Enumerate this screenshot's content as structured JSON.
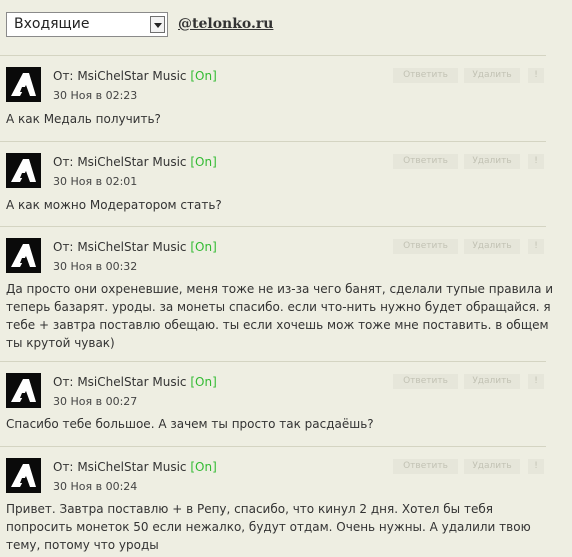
{
  "header": {
    "folder_select": "Входящие",
    "site_link": "@telonko.ru"
  },
  "actions": {
    "reply": "Ответить",
    "delete": "Удалить",
    "more": "!"
  },
  "messages": [
    {
      "from_prefix": "От:",
      "sender": "MsiChelStar Music",
      "status": "[On]",
      "date": "30 Ноя в 02:23",
      "body": "А как Медаль получить?"
    },
    {
      "from_prefix": "От:",
      "sender": "MsiChelStar Music",
      "status": "[On]",
      "date": "30 Ноя в 02:01",
      "body": "А как можно Модератором стать?"
    },
    {
      "from_prefix": "От:",
      "sender": "MsiChelStar Music",
      "status": "[On]",
      "date": "30 Ноя в 00:32",
      "body": "Да просто они охреневшие, меня тоже не из-за чего банят, сделали тупые правила и теперь базарят. уроды. за монеты спасибо. если что-нить нужно будет обращайся. я тебе + завтра поставлю обещаю. ты если хочешь мож тоже мне поставить. в общем ты крутой чувак)"
    },
    {
      "from_prefix": "От:",
      "sender": "MsiChelStar Music",
      "status": "[On]",
      "date": "30 Ноя в 00:27",
      "body": "Спасибо тебе большое. А зачем ты просто так расдаёшь?"
    },
    {
      "from_prefix": "От:",
      "sender": "MsiChelStar Music",
      "status": "[On]",
      "date": "30 Ноя в 00:24",
      "body": "Привет. Завтра поставлю + в Репу, спасибо, что кинул 2 дня. Хотел бы тебя попросить монеток 50 если нежалко, будут отдам. Очень нужны. А удалили твою тему, потому что уроды"
    }
  ]
}
